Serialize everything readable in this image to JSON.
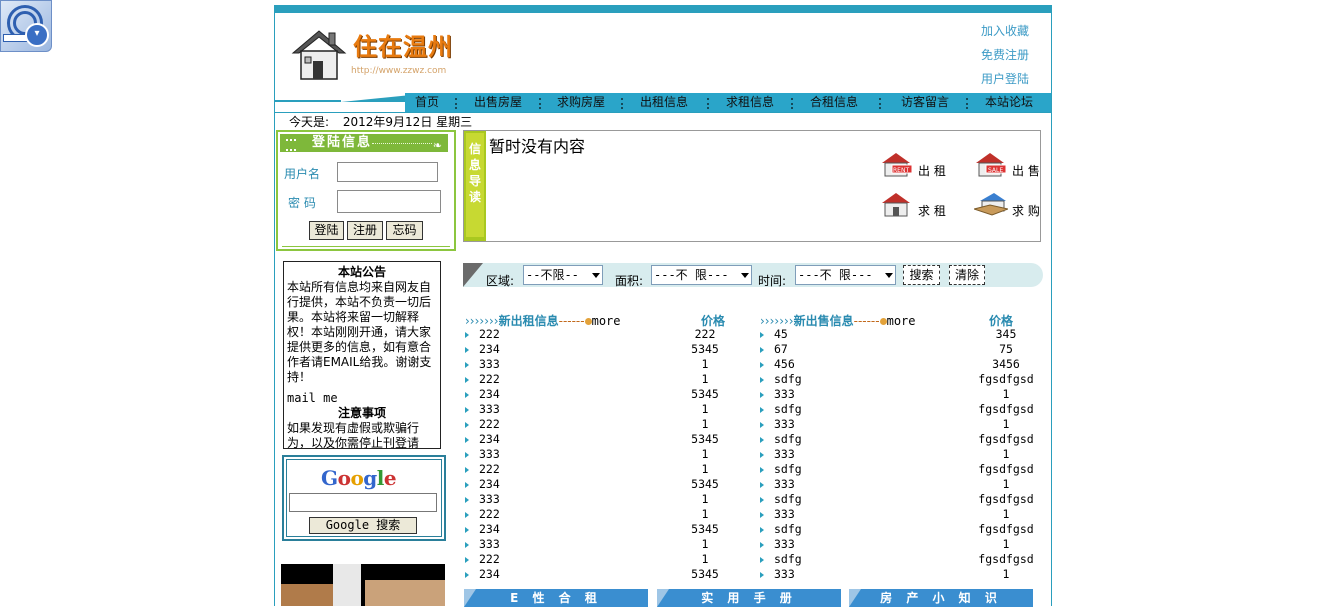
{
  "header": {
    "logo_title": "住在温州",
    "logo_url": "http://www.zzwz.com",
    "links": [
      "加入收藏",
      "免费注册",
      "用户登陆"
    ]
  },
  "nav": {
    "items": [
      "首页",
      "出售房屋",
      "求购房屋",
      "出租信息",
      "求租信息",
      "合租信息",
      "访客留言",
      "本站论坛"
    ]
  },
  "date": {
    "label": "今天是:",
    "value": "2012年9月12日 星期三"
  },
  "login": {
    "title": "登陆信息",
    "username_label": "用户名",
    "password_label": "密 码",
    "buttons": [
      "登陆",
      "注册",
      "忘码"
    ]
  },
  "notice": {
    "title": "本站公告",
    "text": "本站所有信息均来自网友自行提供，本站不负责一切后果。本站将来留一切解释权！本站刚刚开通，请大家提供更多的信息，如有意合作者请EMAIL给我。谢谢支持！",
    "mail": "mail me",
    "title2": "注意事项",
    "text2": "如果发现有虚假或欺骗行为，以及你需停止刊登请"
  },
  "google": {
    "logo": "Google",
    "button": "Google 搜索"
  },
  "guide": {
    "side_label": [
      "信",
      "息",
      "导",
      "读"
    ],
    "empty_text": "暂时没有内容",
    "icons": [
      {
        "label": "出 租",
        "icon": "house-rent-icon"
      },
      {
        "label": "出 售",
        "icon": "house-sale-icon"
      },
      {
        "label": "求 租",
        "icon": "house-seek-rent-icon"
      },
      {
        "label": "求 购",
        "icon": "house-buy-icon"
      }
    ]
  },
  "search": {
    "area_label": "区域:",
    "area_value": "--不限--",
    "size_label": "面积:",
    "size_value": "---不 限---",
    "time_label": "时间:",
    "time_value": "---不 限---",
    "search_button": "搜索",
    "clear_button": "清除"
  },
  "rent_list": {
    "arrows": "›››››››",
    "title": "新出租信息",
    "dashes": "------",
    "more": "more",
    "price_header": "价格",
    "rows": [
      {
        "name": "222",
        "price": "222"
      },
      {
        "name": "234",
        "price": "5345"
      },
      {
        "name": "333",
        "price": "1"
      },
      {
        "name": "222",
        "price": "1"
      },
      {
        "name": "234",
        "price": "5345"
      },
      {
        "name": "333",
        "price": "1"
      },
      {
        "name": "222",
        "price": "1"
      },
      {
        "name": "234",
        "price": "5345"
      },
      {
        "name": "333",
        "price": "1"
      },
      {
        "name": "222",
        "price": "1"
      },
      {
        "name": "234",
        "price": "5345"
      },
      {
        "name": "333",
        "price": "1"
      },
      {
        "name": "222",
        "price": "1"
      },
      {
        "name": "234",
        "price": "5345"
      },
      {
        "name": "333",
        "price": "1"
      },
      {
        "name": "222",
        "price": "1"
      },
      {
        "name": "234",
        "price": "5345"
      }
    ]
  },
  "sale_list": {
    "arrows": "›››››››",
    "title": "新出售信息",
    "dashes": "------",
    "more": "more",
    "price_header": "价格",
    "rows": [
      {
        "name": "45",
        "price": "345"
      },
      {
        "name": "67",
        "price": "75"
      },
      {
        "name": "456",
        "price": "3456"
      },
      {
        "name": "sdfg",
        "price": "fgsdfgsd"
      },
      {
        "name": "333",
        "price": "1"
      },
      {
        "name": "sdfg",
        "price": "fgsdfgsd"
      },
      {
        "name": "333",
        "price": "1"
      },
      {
        "name": "sdfg",
        "price": "fgsdfgsd"
      },
      {
        "name": "333",
        "price": "1"
      },
      {
        "name": "sdfg",
        "price": "fgsdfgsd"
      },
      {
        "name": "333",
        "price": "1"
      },
      {
        "name": "sdfg",
        "price": "fgsdfgsd"
      },
      {
        "name": "333",
        "price": "1"
      },
      {
        "name": "sdfg",
        "price": "fgsdfgsd"
      },
      {
        "name": "333",
        "price": "1"
      },
      {
        "name": "sdfg",
        "price": "fgsdfgsd"
      },
      {
        "name": "333",
        "price": "1"
      }
    ]
  },
  "bottom_tabs": [
    "E 性 合 租",
    "实 用 手 册",
    "房 产 小 知 识"
  ],
  "colors": {
    "primary": "#2a9fbd",
    "login_green": "#8cc63f",
    "link": "#3d9bc6",
    "tab_blue": "#3a8ed0"
  }
}
